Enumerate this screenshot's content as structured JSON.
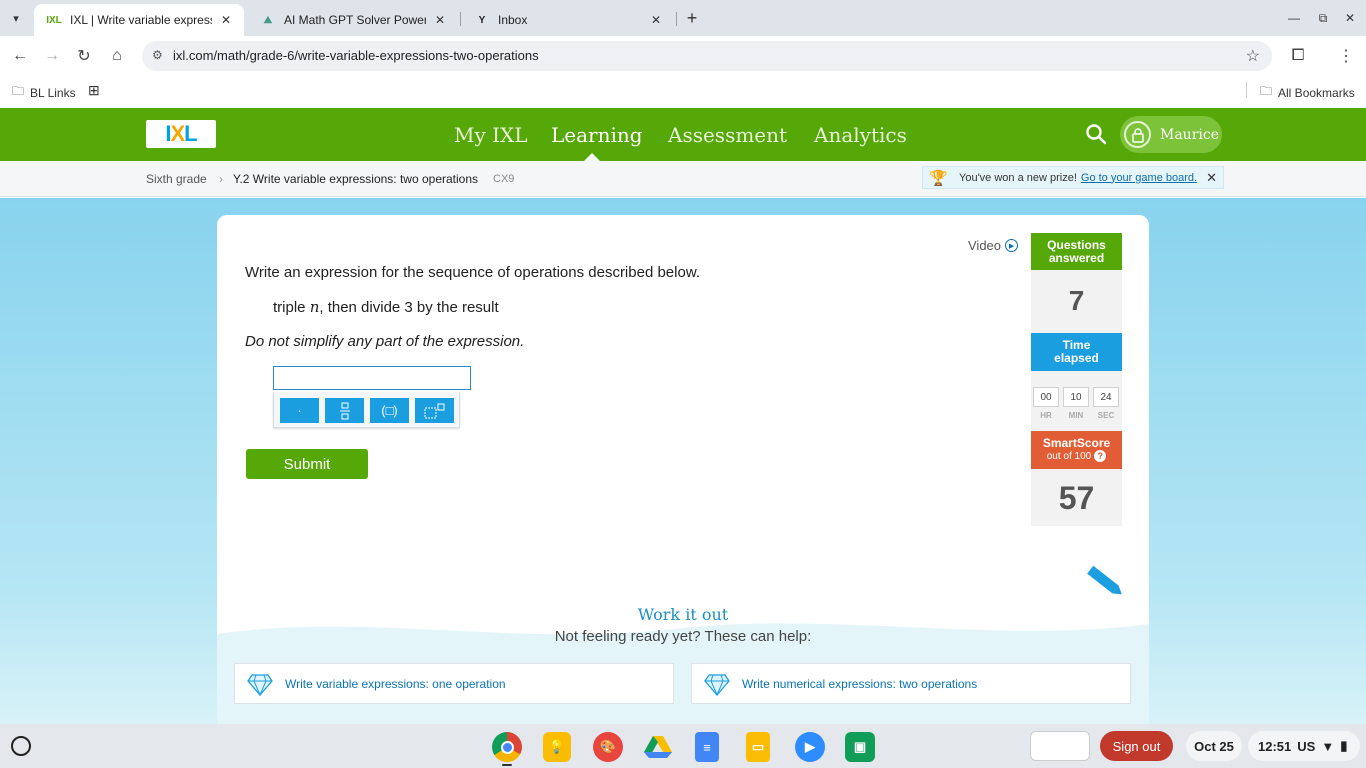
{
  "browser": {
    "tabs": [
      {
        "title": "IXL | Write variable expressions",
        "active": true
      },
      {
        "title": "AI Math GPT Solver Powered by",
        "active": false
      },
      {
        "title": "Inbox",
        "active": false
      }
    ],
    "url": "ixl.com/math/grade-6/write-variable-expressions-two-operations",
    "bookmarks": {
      "bl_links": "BL Links",
      "all_bookmarks": "All Bookmarks"
    }
  },
  "ixl": {
    "logo_text": "IXL",
    "nav": [
      "My IXL",
      "Learning",
      "Assessment",
      "Analytics"
    ],
    "active_nav": "Learning",
    "user_name": "Maurice",
    "breadcrumb": {
      "grade": "Sixth grade",
      "skill": "Y.2 Write variable expressions: two operations",
      "code": "CX9"
    },
    "prize": {
      "text": "You've won a new prize!",
      "link": "Go to your game board."
    }
  },
  "question": {
    "video_label": "Video",
    "instruction": "Write an expression for the sequence of operations described below.",
    "sequence_pre": "triple ",
    "sequence_var": "n",
    "sequence_post": ", then divide 3 by the result",
    "note": "Do not simplify any part of the expression.",
    "answer_value": "",
    "keypad": [
      "·",
      "fraction",
      "(□)",
      "exponent"
    ],
    "submit_label": "Submit"
  },
  "stats": {
    "questions_answered_label_1": "Questions",
    "questions_answered_label_2": "answered",
    "questions_answered": "7",
    "time_label_1": "Time",
    "time_label_2": "elapsed",
    "time": {
      "hr": "00",
      "min": "10",
      "sec": "24"
    },
    "time_units": {
      "hr": "HR",
      "min": "MIN",
      "sec": "SEC"
    },
    "smartscore_label": "SmartScore",
    "smartscore_sub": "out of 100",
    "smartscore": "57",
    "colors": {
      "questions": "#56a708",
      "time": "#1a9ee0",
      "smartscore": "#e15d35"
    }
  },
  "work_it_out": {
    "title": "Work it out",
    "subtitle": "Not feeling ready yet? These can help:",
    "links": [
      "Write variable expressions: one operation",
      "Write numerical expressions: two operations"
    ]
  },
  "shelf": {
    "apps": [
      "chrome-icon",
      "keep-icon",
      "canvas-icon",
      "drive-icon",
      "docs-icon",
      "slides-icon",
      "zoom-icon",
      "classroom-icon"
    ],
    "sign_out": "Sign out",
    "date": "Oct 25",
    "time": "12:51",
    "region": "US"
  }
}
